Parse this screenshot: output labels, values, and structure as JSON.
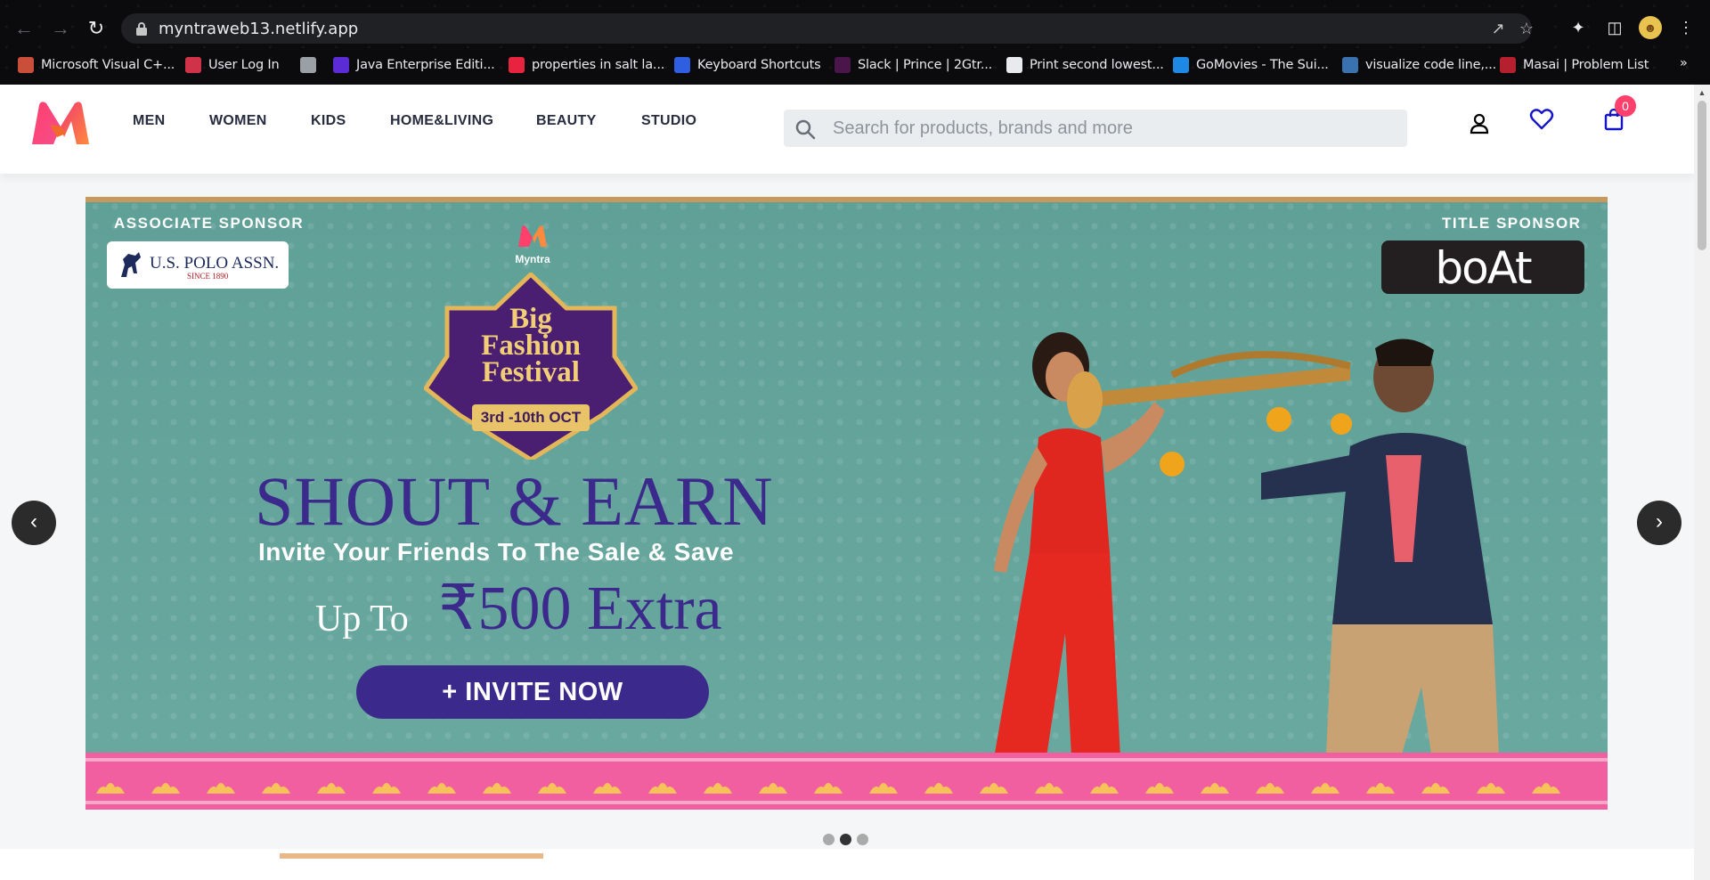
{
  "browser": {
    "url": "myntraweb13.netlify.app",
    "bookmarks": [
      {
        "label": "Microsoft Visual C+...",
        "color": "#c94f3b"
      },
      {
        "label": "User Log In",
        "color": "#d0324a"
      },
      {
        "label": "",
        "color": "#9aa0a6"
      },
      {
        "label": "Java Enterprise Editi...",
        "color": "#5b2bd6"
      },
      {
        "label": "properties in salt la...",
        "color": "#e8233f"
      },
      {
        "label": "Keyboard Shortcuts",
        "color": "#2f5fe0"
      },
      {
        "label": "Slack | Prince | 2Gtr...",
        "color": "#4a154b"
      },
      {
        "label": "Print second lowest...",
        "color": "#e8eaed"
      },
      {
        "label": "GoMovies - The Sui...",
        "color": "#1e88e5"
      },
      {
        "label": "visualize code line,...",
        "color": "#3a72b0"
      },
      {
        "label": "Masai | Problem List",
        "color": "#b51f2e"
      }
    ],
    "more": "»"
  },
  "header": {
    "nav": [
      "MEN",
      "WOMEN",
      "KIDS",
      "HOME&LIVING",
      "BEAUTY",
      "STUDIO"
    ],
    "search_placeholder": "Search for products, brands and more",
    "bag_count": "0",
    "accent": "#ff3f6c"
  },
  "banner": {
    "associate_label": "ASSOCIATE SPONSOR",
    "title_label": "TITLE SPONSOR",
    "polo_name": "U.S. POLO ASSN.",
    "polo_since": "SINCE 1890",
    "boat_name": "boAt",
    "myntra_small": "Myntra",
    "festival_line1": "Big",
    "festival_line2": "Fashion",
    "festival_line3": "Festival",
    "festival_dates": "3rd -10th OCT",
    "headline": "SHOUT & EARN",
    "subline": "Invite Your Friends To The Sale & Save",
    "upto": "Up To",
    "amount": "₹500 Extra",
    "cta": "+ INVITE NOW"
  },
  "carousel": {
    "prev": "‹",
    "next": "›",
    "slides": 3,
    "active": 2
  }
}
